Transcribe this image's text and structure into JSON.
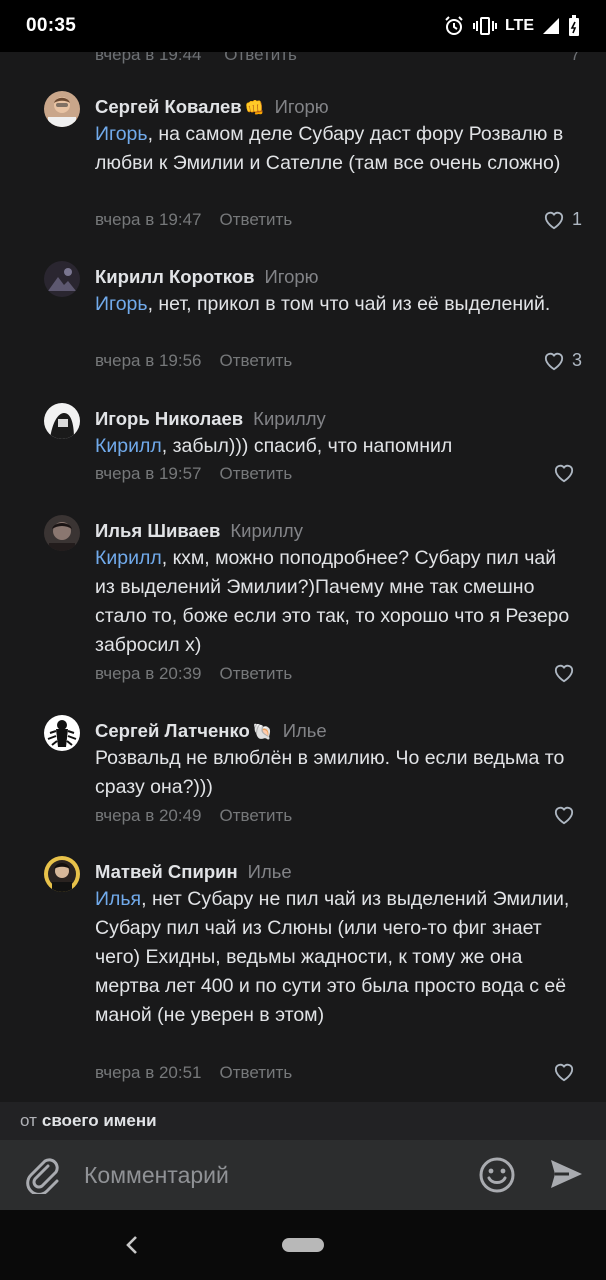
{
  "status_bar": {
    "time": "00:35",
    "network": "LTE"
  },
  "top_partial": {
    "date": "вчера в 19:44",
    "reply_label": "Ответить",
    "likes": "7"
  },
  "comments": [
    {
      "author": "Сергей Ковалев",
      "emoji": "👊",
      "reply_to": "Игорю",
      "mention": "Игорь",
      "text": ", на самом деле Субару даст фору Розвалю в любви к Эмилии и Сателле (там все очень сложно)",
      "date": "вчера в 19:47",
      "reply_label": "Ответить",
      "likes": "1"
    },
    {
      "author": "Кирилл Коротков",
      "emoji": "",
      "reply_to": "Игорю",
      "mention": "Игорь",
      "text": ", нет, прикол в том что чай из её выделений.",
      "date": "вчера в 19:56",
      "reply_label": "Ответить",
      "likes": "3"
    },
    {
      "author": "Игорь Николаев",
      "emoji": "",
      "reply_to": "Кириллу",
      "mention": "Кирилл",
      "text": ", забыл))) спасиб, что напомнил",
      "date": "вчера в 19:57",
      "reply_label": "Ответить",
      "likes": ""
    },
    {
      "author": "Илья Шиваев",
      "emoji": "",
      "reply_to": "Кириллу",
      "mention": "Кирилл",
      "text": ", кхм, можно поподробнее? Субару пил чай из выделений Эмилии?)Пачему мне так смешно стало то, боже если это так, то хорошо что я Резеро забросил х)",
      "date": "вчера в 20:39",
      "reply_label": "Ответить",
      "likes": ""
    },
    {
      "author": "Сергей Латченко",
      "emoji": "🐚",
      "reply_to": "Илье",
      "mention": "",
      "text": "Розвальд не влюблён в эмилию. Чо если ведьма то сразу она?)))",
      "date": "вчера в 20:49",
      "reply_label": "Ответить",
      "likes": ""
    },
    {
      "author": "Матвей Спирин",
      "emoji": "",
      "reply_to": "Илье",
      "mention": "Илья",
      "text": ", нет Субару не пил чай из выделений Эмилии, Субару пил чай из Слюны (или чего-то фиг знает чего) Ехидны, ведьмы жадности, к тому же она мертва лет 400 и по сути это была просто вода с её маной (не уверен в этом)",
      "date": "вчера в 20:51",
      "reply_label": "Ответить",
      "likes": ""
    }
  ],
  "composer": {
    "from_prefix": "от",
    "from_name": "своего имени",
    "placeholder": "Комментарий"
  },
  "icons": {
    "attach": "paperclip-icon",
    "emoji": "smiley-icon",
    "send": "send-arrow-icon",
    "like": "heart-outline-icon",
    "back": "nav-back-icon"
  },
  "colors": {
    "background": "#19191a",
    "mention": "#71aaeb",
    "meta": "#76787a",
    "input_bar": "#2c2d2e"
  }
}
